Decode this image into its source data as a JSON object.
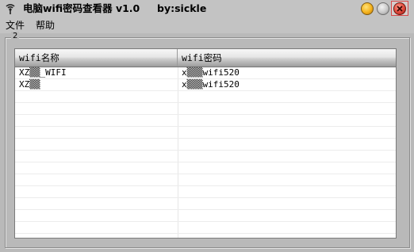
{
  "window": {
    "title": "电脑wifi密码查看器 v1.0     by:sickle"
  },
  "menu": {
    "items": [
      {
        "label": "文件"
      },
      {
        "label": "帮助"
      }
    ]
  },
  "group": {
    "label": "2"
  },
  "list": {
    "columns": [
      "wifi名称",
      "wifi密码"
    ],
    "rows": [
      {
        "name": "XZ▒▒_WIFI",
        "password": "x▒▒▒wifi520"
      },
      {
        "name": "XZ▒▒",
        "password": "x▒▒▒wifi520"
      }
    ],
    "empty_rows": 12
  },
  "colors": {
    "window_bg": "#b9b9b9",
    "close_accent": "#e0473a",
    "minimize_accent": "#f4b21c"
  }
}
